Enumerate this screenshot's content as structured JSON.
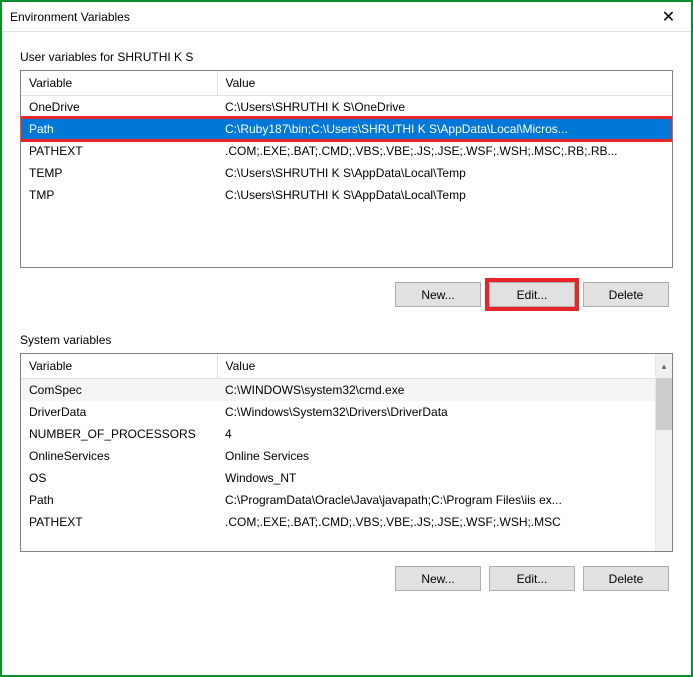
{
  "window": {
    "title": "Environment Variables",
    "close_label": "✕"
  },
  "user_section": {
    "label": "User variables for SHRUTHI K S",
    "headers": {
      "variable": "Variable",
      "value": "Value"
    },
    "rows": [
      {
        "variable": "OneDrive",
        "value": "C:\\Users\\SHRUTHI K S\\OneDrive"
      },
      {
        "variable": "Path",
        "value": "C:\\Ruby187\\bin;C:\\Users\\SHRUTHI K S\\AppData\\Local\\Micros..."
      },
      {
        "variable": "PATHEXT",
        "value": ".COM;.EXE;.BAT;.CMD;.VBS;.VBE;.JS;.JSE;.WSF;.WSH;.MSC;.RB;.RB..."
      },
      {
        "variable": "TEMP",
        "value": "C:\\Users\\SHRUTHI K S\\AppData\\Local\\Temp"
      },
      {
        "variable": "TMP",
        "value": "C:\\Users\\SHRUTHI K S\\AppData\\Local\\Temp"
      }
    ],
    "buttons": {
      "new": "New...",
      "edit": "Edit...",
      "delete": "Delete"
    }
  },
  "system_section": {
    "label": "System variables",
    "headers": {
      "variable": "Variable",
      "value": "Value"
    },
    "rows": [
      {
        "variable": "ComSpec",
        "value": "C:\\WINDOWS\\system32\\cmd.exe"
      },
      {
        "variable": "DriverData",
        "value": "C:\\Windows\\System32\\Drivers\\DriverData"
      },
      {
        "variable": "NUMBER_OF_PROCESSORS",
        "value": "4"
      },
      {
        "variable": "OnlineServices",
        "value": "Online Services"
      },
      {
        "variable": "OS",
        "value": "Windows_NT"
      },
      {
        "variable": "Path",
        "value": "C:\\ProgramData\\Oracle\\Java\\javapath;C:\\Program Files\\iis ex..."
      },
      {
        "variable": "PATHEXT",
        "value": ".COM;.EXE;.BAT;.CMD;.VBS;.VBE;.JS;.JSE;.WSF;.WSH;.MSC"
      }
    ],
    "buttons": {
      "new": "New...",
      "edit": "Edit...",
      "delete": "Delete"
    }
  }
}
